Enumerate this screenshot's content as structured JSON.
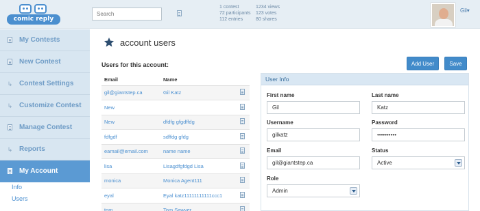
{
  "header": {
    "logo_text": "comic reply",
    "search": {
      "placeholder": "Search",
      "value": ""
    },
    "stats_left": [
      "1 contest",
      "72 participants",
      "112 entries"
    ],
    "stats_right": [
      "1234 views",
      "123 votes",
      "80 shares"
    ],
    "user_name": "Gil"
  },
  "sidebar": {
    "items": [
      {
        "label": "My Contests",
        "icon": "doc-icon"
      },
      {
        "label": "New Contest",
        "icon": "doc-icon"
      },
      {
        "label": "Contest Settings",
        "icon": "fold-arrow-icon"
      },
      {
        "label": "Customize Contest",
        "icon": "fold-arrow-icon"
      },
      {
        "label": "Manage Contest",
        "icon": "doc-icon"
      },
      {
        "label": "Reports",
        "icon": "fold-arrow-icon"
      },
      {
        "label": "My Account",
        "icon": "doc-icon",
        "active": true
      }
    ],
    "sub_items": [
      "Info",
      "Users"
    ]
  },
  "main": {
    "title": "account users",
    "section_label": "Users for this account:",
    "add_user_label": "Add User",
    "save_label": "Save",
    "table": {
      "headers": [
        "Email",
        "Name"
      ],
      "rows": [
        {
          "email": "gil@giantstep.ca",
          "name": "Gil Katz"
        },
        {
          "email": "New",
          "name": ""
        },
        {
          "email": "New",
          "name": "dfdfg gfgdffdg"
        },
        {
          "email": "fdfgdf",
          "name": "sdffdg gfdg"
        },
        {
          "email": "eamail@email.com",
          "name": "name name"
        },
        {
          "email": "lisa",
          "name": "Lisagdfgfdgd Lisa"
        },
        {
          "email": "monica",
          "name": "Monica Agent111"
        },
        {
          "email": "eyal",
          "name": "Eyal katz11111111111ccc1"
        },
        {
          "email": "tom",
          "name": "Tom Sawyer"
        }
      ]
    },
    "user_info": {
      "title": "User Info",
      "first_name_label": "First name",
      "first_name": "Gil",
      "last_name_label": "Last name",
      "last_name": "Katz",
      "username_label": "Username",
      "username": "gilkatz",
      "password_label": "Password",
      "password": "••••••••••",
      "email_label": "Email",
      "email": "gil@giantstep.ca",
      "status_label": "Status",
      "status": "Active",
      "role_label": "Role",
      "role": "Admin"
    }
  },
  "colors": {
    "accent": "#428bca",
    "nav_bg": "#d8e6f1",
    "nav_active": "#5b9ad3",
    "link": "#4a8fd0"
  }
}
